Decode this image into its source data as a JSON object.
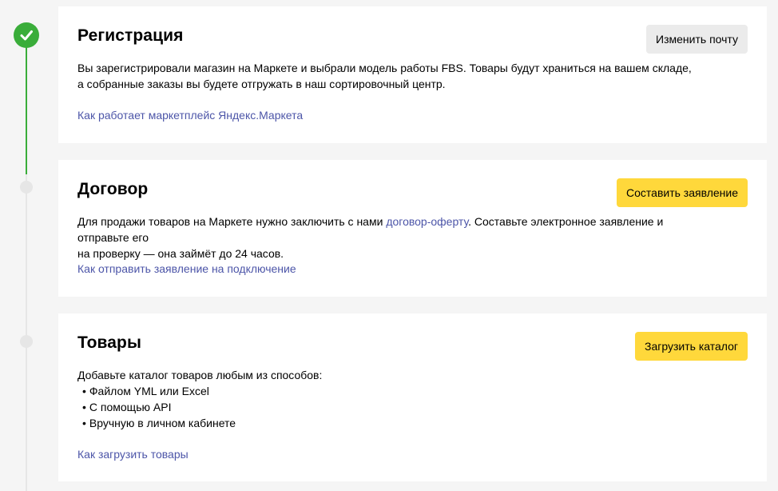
{
  "steps": [
    {
      "title": "Регистрация",
      "button": "Изменить почту",
      "desc_line1": "Вы зарегистрировали магазин на Маркете и выбрали модель работы FBS. Товары будут храниться на вашем складе,",
      "desc_line2": "а собранные заказы вы будете отгружать в наш сортировочный центр.",
      "link": "Как работает маркетплейс Яндекс.Маркета"
    },
    {
      "title": "Договор",
      "button": "Составить заявление",
      "desc_before": "Для продажи товаров на Маркете нужно заключить с нами ",
      "desc_link": "договор-оферту",
      "desc_after": ". Составьте электронное заявление и отправьте его",
      "desc_line2": "на проверку — она займёт до 24 часов.",
      "link": "Как отправить заявление на подключение"
    },
    {
      "title": "Товары",
      "button": "Загрузить каталог",
      "desc_intro": "Добавьте каталог товаров любым из способов:",
      "methods": [
        "Файлом YML или Excel",
        "С помощью API",
        "Вручную  в личном кабинете"
      ],
      "link": "Как загрузить товары"
    }
  ],
  "colors": {
    "done": "#3aad3a",
    "pending": "#e6e6e6",
    "accent_button": "#ffd83b",
    "link": "#4c55a8"
  }
}
